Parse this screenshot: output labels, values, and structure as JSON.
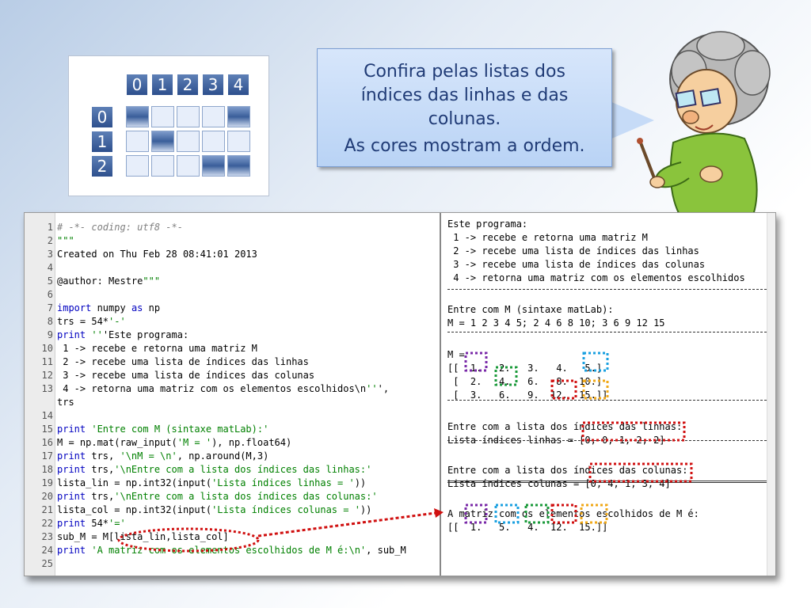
{
  "diagram": {
    "column_indices": [
      "0",
      "1",
      "2",
      "3",
      "4"
    ],
    "row_indices": [
      "0",
      "1",
      "2"
    ]
  },
  "bubble": {
    "line1": "Confira pelas listas dos",
    "line2": "índices das linhas e das",
    "line3": "colunas.",
    "line4": "As cores mostram a ordem."
  },
  "editor": {
    "line_numbers": [
      "1",
      "2",
      "3",
      "4",
      "5",
      "6",
      "7",
      "8",
      "9",
      "10",
      "11",
      "12",
      "13",
      "",
      "14",
      "15",
      "16",
      "17",
      "18",
      "19",
      "20",
      "21",
      "22",
      "23",
      "24",
      "25"
    ],
    "lines": [
      "# -*- coding: utf8 -*-",
      "\"\"\"",
      "Created on Thu Feb 28 08:41:01 2013",
      "",
      "@author: Mestre\"\"\"",
      "",
      "import numpy as np",
      "trs = 54*'-'",
      "print '''Este programa:",
      " 1 -> recebe e retorna uma matriz M",
      " 2 -> recebe uma lista de índices das linhas",
      " 3 -> recebe uma lista de índices das colunas",
      " 4 -> retorna uma matriz com os elementos escolhidos\\n''',",
      "trs",
      "",
      "print 'Entre com M (sintaxe matLab):'",
      "M = np.mat(raw_input('M = '), np.float64)",
      "print trs, '\\nM = \\n', np.around(M,3)",
      "print trs,'\\nEntre com a lista dos índices das linhas:'",
      "lista_lin = np.int32(input('Lista índices linhas = '))",
      "print trs,'\\nEntre com a lista dos índices das colunas:'",
      "lista_col = np.int32(input('Lista índices colunas = '))",
      "print 54*'='",
      "sub_M = M[lista_lin,lista_col]",
      "print 'A matriz com os elementos escolhidos de M é:\\n', sub_M",
      ""
    ]
  },
  "console": {
    "lines": [
      "Este programa:",
      " 1 -> recebe e retorna uma matriz M",
      " 2 -> recebe uma lista de índices das linhas",
      " 3 -> recebe uma lista de índices das colunas",
      " 4 -> retorna uma matriz com os elementos escolhidos",
      "",
      "Entre com M (sintaxe matLab):",
      "M = 1 2 3 4 5; 2 4 6 8 10; 3 6 9 12 15",
      "",
      "M =",
      "[[  1.   2.   3.   4.   5.]",
      " [  2.   4.   6.   8.  10.]",
      " [  3.   6.   9.  12.  15.]]",
      "",
      "Entre com a lista dos índices das linhas:",
      "Lista índices linhas = [0, 0, 1, 2, 2]",
      "",
      "Entre com a lista dos índices das colunas:",
      "Lista índices colunas = [0, 4, 1, 3, 4]",
      "",
      "A matriz com os elementos escolhidos de M é:",
      "[[  1.   5.   4.  12.  15.]]"
    ]
  },
  "highlight_colors": {
    "purple": "#7a2aa8",
    "blue": "#1aa0e0",
    "green": "#1a9a3a",
    "red": "#d01010",
    "orange": "#f0a818"
  }
}
